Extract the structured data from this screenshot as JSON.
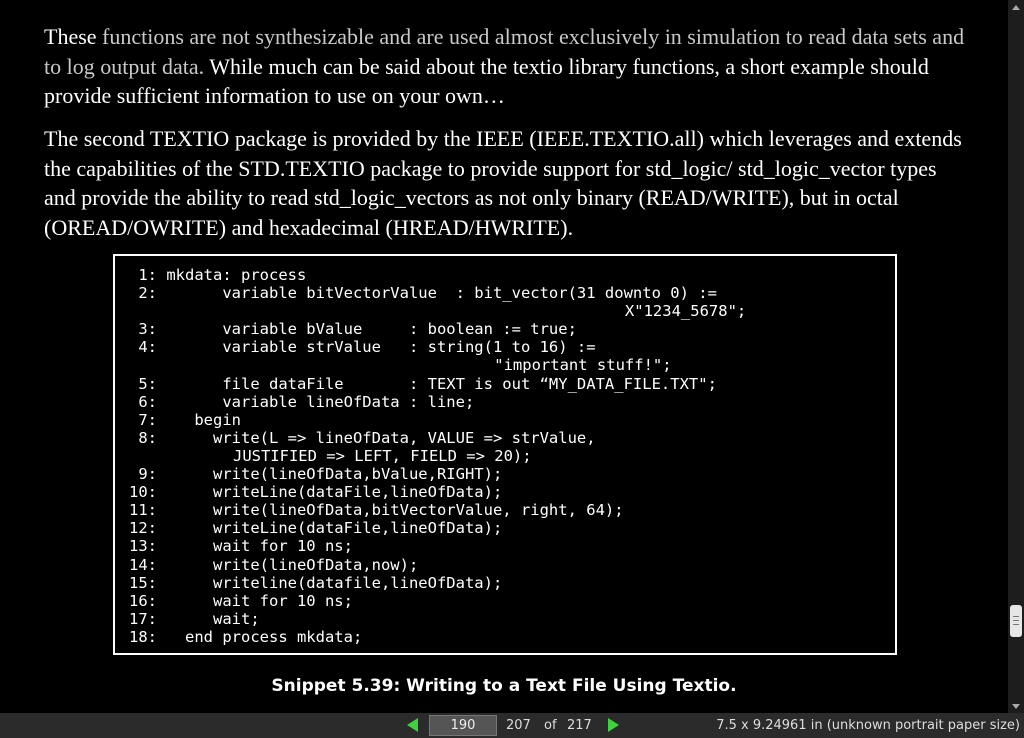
{
  "document": {
    "paragraph1": {
      "lead": "These",
      "highlight": " functions are not synthesizable and are used almost exclusively in simulation to read data sets and to log output data.",
      "rest": " While much can be said about the textio library functions, a short example should provide sufficient information to use on your own…"
    },
    "paragraph2": "The second TEXTIO package is provided by the IEEE (IEEE.TEXTIO.all) which leverages and extends the capabilities of the STD.TEXTIO package to provide support for std_logic/ std_logic_vector types and provide the ability to read std_logic_vectors as not only binary (READ/WRITE), but in octal (OREAD/OWRITE) and hexadecimal (HREAD/HWRITE).",
    "code_lines": [
      {
        "n": "1:",
        "text": " mkdata: process"
      },
      {
        "n": "2:",
        "text": "       variable bitVectorValue  : bit_vector(31 downto 0) :=\n                                                      X\"1234_5678\";"
      },
      {
        "n": "3:",
        "text": "       variable bValue     : boolean := true;"
      },
      {
        "n": "4:",
        "text": "       variable strValue   : string(1 to 16) :=\n                                        \"important stuff!\";"
      },
      {
        "n": "5:",
        "text": "       file dataFile       : TEXT is out “MY_DATA_FILE.TXT\";"
      },
      {
        "n": "6:",
        "text": "       variable lineOfData : line;"
      },
      {
        "n": "7:",
        "text": "    begin"
      },
      {
        "n": "8:",
        "text": "      write(L => lineOfData, VALUE => strValue,\n            JUSTIFIED => LEFT, FIELD => 20);"
      },
      {
        "n": "9:",
        "text": "      write(lineOfData,bValue,RIGHT);"
      },
      {
        "n": "10:",
        "text": "      writeLine(dataFile,lineOfData);"
      },
      {
        "n": "11:",
        "text": "      write(lineOfData,bitVectorValue, right, 64);"
      },
      {
        "n": "12:",
        "text": "      writeLine(dataFile,lineOfData);"
      },
      {
        "n": "13:",
        "text": "      wait for 10 ns;"
      },
      {
        "n": "14:",
        "text": "      write(lineOfData,now);"
      },
      {
        "n": "15:",
        "text": "      writeline(datafile,lineOfData);"
      },
      {
        "n": "16:",
        "text": "      wait for 10 ns;"
      },
      {
        "n": "17:",
        "text": "      wait;"
      },
      {
        "n": "18:",
        "text": "   end process mkdata;"
      }
    ],
    "caption": "Snippet 5.39: Writing to a Text File Using Textio."
  },
  "statusbar": {
    "page_input_value": "190",
    "current_page": "207",
    "of_label": "of",
    "total_pages": "217",
    "paper_size": "7.5 x 9.24961 in (unknown portrait paper size)",
    "prev_icon": "green-left-triangle",
    "next_icon": "green-right-triangle"
  },
  "scrollbar": {
    "thumb_position": 0.905
  },
  "colors": {
    "background": "#000000",
    "text": "#ffffff",
    "highlight_text": "#c9c9c9",
    "nav_arrow": "#3fd13f",
    "statusbar": "#2b2b2b"
  }
}
